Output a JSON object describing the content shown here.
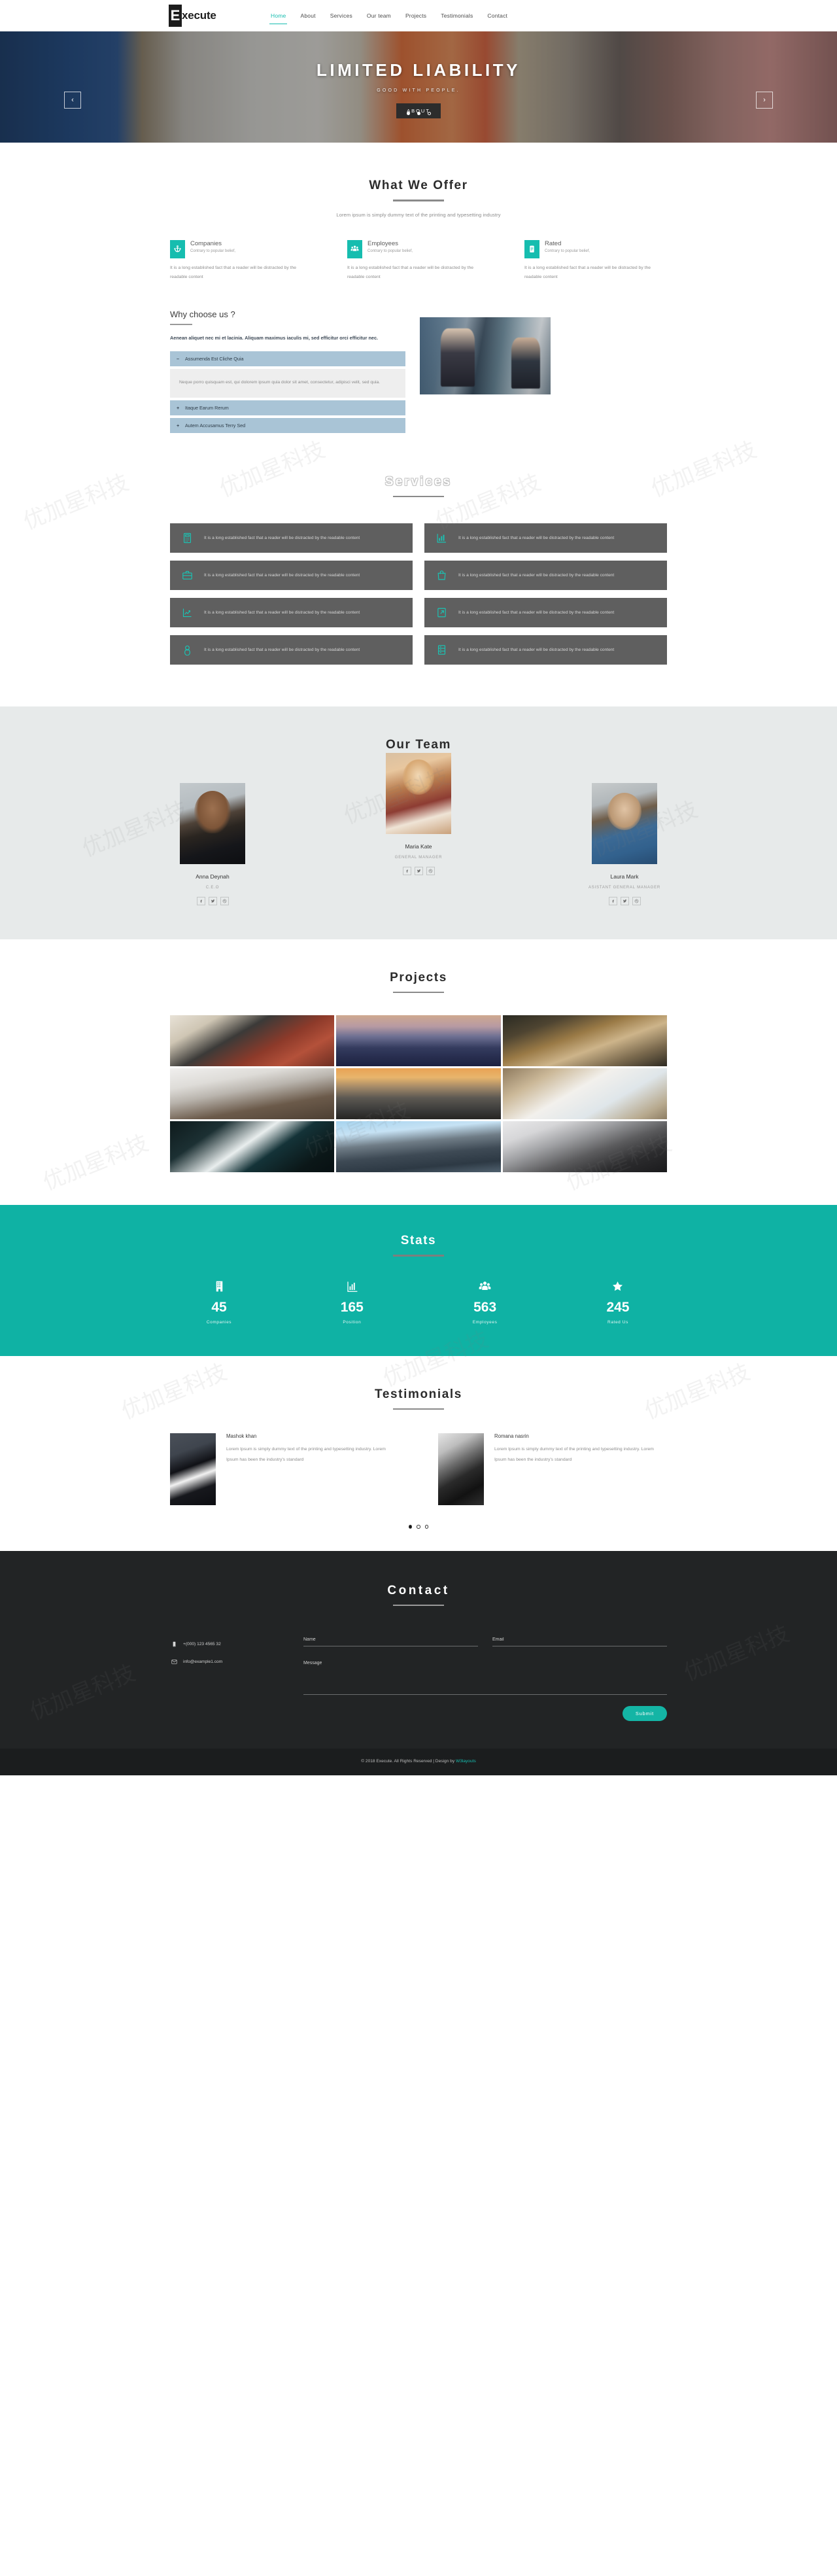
{
  "brand": {
    "mark": "E",
    "name": "xecute",
    "full": "Execute"
  },
  "nav": {
    "items": [
      {
        "label": "Home",
        "active": true
      },
      {
        "label": "About",
        "active": false
      },
      {
        "label": "Services",
        "active": false
      },
      {
        "label": "Our team",
        "active": false
      },
      {
        "label": "Projects",
        "active": false
      },
      {
        "label": "Testimonials",
        "active": false
      },
      {
        "label": "Contact",
        "active": false
      }
    ]
  },
  "hero": {
    "title": "LIMITED LIABILITY",
    "subtitle": "GOOD WITH PEOPLE.",
    "button": "ABOUT",
    "prev_icon": "chevron-left-icon",
    "next_icon": "chevron-right-icon",
    "dots": [
      "filled",
      "filled",
      "hollow"
    ]
  },
  "offer": {
    "title": "What We Offer",
    "description": "Lorem ipsum is simply dummy text of the printing and typesetting industry",
    "items": [
      {
        "icon": "anchor-icon",
        "name": "Companies",
        "tagline": "Contrary to popular belief,",
        "body": "It is a long established fact that a reader will be distracted by the readable content"
      },
      {
        "icon": "users-icon",
        "name": "Employees",
        "tagline": "Contrary to popular belief,",
        "body": "It is a long established fact that a reader will be distracted by the readable content"
      },
      {
        "icon": "clipboard-icon",
        "name": "Rated",
        "tagline": "Contrary to popular belief,",
        "body": "It is a long established fact that a reader will be distracted by the readable content"
      }
    ]
  },
  "why": {
    "title": "Why choose us ?",
    "lead": "Aenean aliquet nec mi et lacinia. Aliquam maximus iaculis mi, sed efficitur orci efficitur nec.",
    "accordion": [
      {
        "sign": "–",
        "label": "Assumenda Est Cliche Quia",
        "open": true,
        "body": "Neque porro quisquam est, qui dolorem ipsum quia dolor sit amet, consectetur, adipisci velit, sed quia."
      },
      {
        "sign": "+",
        "label": "Itaque Earum Rerum",
        "open": false,
        "body": ""
      },
      {
        "sign": "+",
        "label": "Autem Accusamus Terry Sed",
        "open": false,
        "body": ""
      }
    ]
  },
  "services": {
    "title": "Services",
    "items": [
      {
        "icon": "calculator-icon",
        "text": "It is a long established fact that a reader will be distracted by the readable content"
      },
      {
        "icon": "bar-chart-icon",
        "text": "It is a long established fact that a reader will be distracted by the readable content"
      },
      {
        "icon": "briefcase-icon",
        "text": "It is a long established fact that a reader will be distracted by the readable content"
      },
      {
        "icon": "shopping-bag-icon",
        "text": "It is a long established fact that a reader will be distracted by the readable content"
      },
      {
        "icon": "line-chart-icon",
        "text": "It is a long established fact that a reader will be distracted by the readable content"
      },
      {
        "icon": "external-link-icon",
        "text": "It is a long established fact that a reader will be distracted by the readable content"
      },
      {
        "icon": "lock-icon",
        "text": "It is a long established fact that a reader will be distracted by the readable content"
      },
      {
        "icon": "server-icon",
        "text": "It is a long established fact that a reader will be distracted by the readable content"
      }
    ]
  },
  "team": {
    "title": "Our Team",
    "members": [
      {
        "name": "Anna Deynah",
        "role": "C.E.O",
        "socials": [
          "facebook-icon",
          "twitter-icon",
          "dribbble-icon"
        ]
      },
      {
        "name": "Maria Kate",
        "role": "GENERAL MANAGER",
        "socials": [
          "facebook-icon",
          "twitter-icon",
          "dribbble-icon"
        ]
      },
      {
        "name": "Laura Mark",
        "role": "ASISTANT GENERAL MANAGER",
        "socials": [
          "facebook-icon",
          "twitter-icon",
          "dribbble-icon"
        ]
      }
    ]
  },
  "projects": {
    "title": "Projects",
    "cells": [
      "team-at-desk",
      "city-skyline-dusk",
      "cafe-meeting",
      "empty-boardroom",
      "city-sunset",
      "laptop-with-charts",
      "buildings-from-below",
      "curved-glass-facade",
      "man-at-computer"
    ]
  },
  "stats": {
    "title": "Stats",
    "items": [
      {
        "icon": "building-icon",
        "value": "45",
        "label": "Companies"
      },
      {
        "icon": "bar-chart-icon",
        "value": "165",
        "label": "Position"
      },
      {
        "icon": "users-icon",
        "value": "563",
        "label": "Employees"
      },
      {
        "icon": "star-icon",
        "value": "245",
        "label": "Rated Us"
      }
    ]
  },
  "testimonials": {
    "title": "Testimonials",
    "items": [
      {
        "name": "Mashok khan",
        "text": "Lorem Ipsum is simply dummy text of the printing and typesetting industry. Lorem Ipsum has been the industry's standard"
      },
      {
        "name": "Romana nasrin",
        "text": "Lorem Ipsum is simply dummy text of the printing and typesetting industry. Lorem Ipsum has been the industry's standard"
      }
    ],
    "dots": [
      "on",
      "off",
      "off"
    ]
  },
  "contact": {
    "title": "Contact",
    "phone_icon": "mobile-icon",
    "phone": "+(000) 123 4565 32",
    "email_icon": "envelope-icon",
    "email": "info@example1.com",
    "name_placeholder": "Name",
    "name_value": "",
    "email_placeholder": "Email",
    "email_value": "",
    "message_placeholder": "Message",
    "message_value": "",
    "submit_label": "Submit"
  },
  "footer": {
    "text_before": "© 2018 Execute. All Rights Reserved | Design by ",
    "link": "W3layouts"
  },
  "colors": {
    "accent": "#16bdaf",
    "stats_bg": "#0fb2a4",
    "service_card": "#5f5f5f",
    "accordion_head": "#a9c4d6",
    "team_bg": "#e7eaea",
    "contact_bg": "#222425",
    "footer_bg": "#1b1d1e"
  }
}
